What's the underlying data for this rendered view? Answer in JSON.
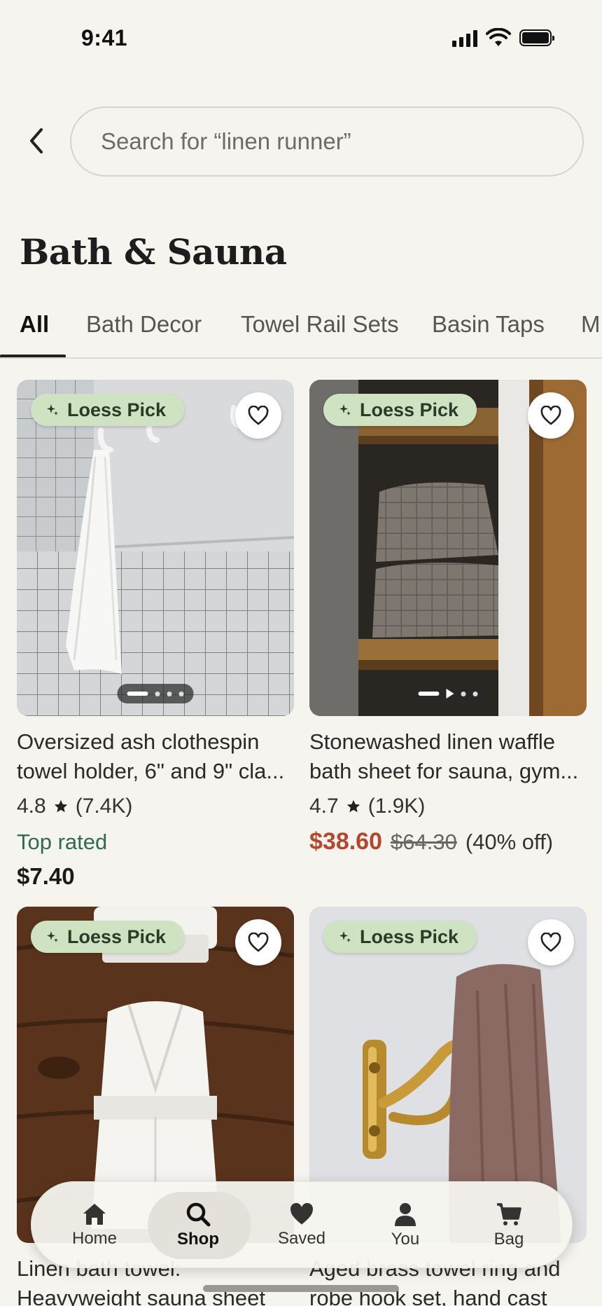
{
  "status_bar": {
    "time": "9:41"
  },
  "search": {
    "placeholder": "Search for “linen runner”"
  },
  "page_title": "Bath & Sauna",
  "tabs": [
    {
      "label": "All",
      "active": true
    },
    {
      "label": "Bath Decor"
    },
    {
      "label": "Towel Rail Sets"
    },
    {
      "label": "Basin Taps"
    },
    {
      "label": "M"
    }
  ],
  "badge_label": "Loess Pick",
  "products": [
    {
      "title_line1": "Oversized ash clothespin",
      "title_line2": "towel holder, 6\" and 9\" cla...",
      "rating": "4.8",
      "reviews": "(7.4K)",
      "tag": "Top rated",
      "price": "$7.40"
    },
    {
      "title_line1": "Stonewashed linen waffle",
      "title_line2": "bath sheet for sauna, gym...",
      "rating": "4.7",
      "reviews": "(1.9K)",
      "sale_price": "$38.60",
      "original_price": "$64.30",
      "discount": "(40% off)"
    },
    {
      "title_line1": "Linen bath towel:",
      "title_line2": "Heavyweight sauna sheet"
    },
    {
      "title_line1": "Aged brass towel ring and",
      "title_line2": "robe hook set, hand cast"
    }
  ],
  "nav": {
    "home": "Home",
    "shop": "Shop",
    "saved": "Saved",
    "you": "You",
    "bag": "Bag"
  },
  "colors": {
    "background": "#f6f4ef",
    "badge": "#cfe3c2",
    "sale_price": "#b4472d",
    "top_rated": "#2f6b4f"
  }
}
